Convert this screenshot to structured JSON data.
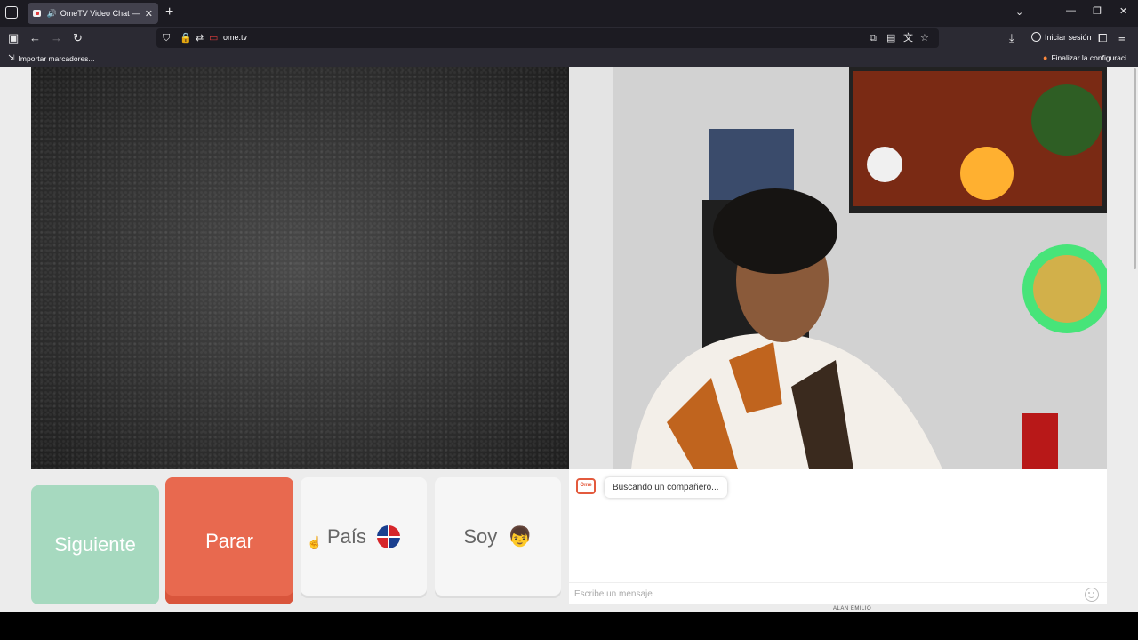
{
  "browser": {
    "tab_title": "OmeTV Video Chat — Ome",
    "url": "ome.tv",
    "signin_label": "Iniciar sesión",
    "bookmarks": {
      "import": "Importar marcadores...",
      "finish_setup": "Finalizar la configuraci..."
    }
  },
  "app": {
    "buttons": {
      "next": "Siguiente",
      "stop": "Parar",
      "country": "País",
      "gender": "Soy"
    },
    "chat": {
      "logo_text": "Ome",
      "status_message": "Buscando un compañero...",
      "input_placeholder": "Escribe un mensaje"
    },
    "bottom_text": "ALAN EMILIO"
  },
  "colors": {
    "next": "#a6d9bf",
    "stop": "#e8694f",
    "neutral_tile": "#f6f6f6"
  }
}
